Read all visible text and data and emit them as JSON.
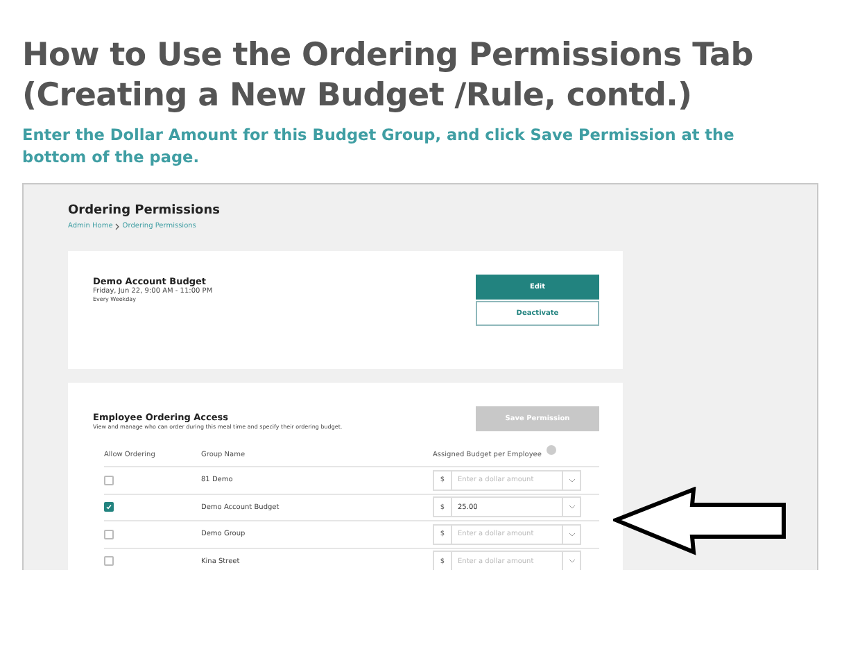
{
  "slide": {
    "title_lines": [
      "How to Use the Ordering Permissions Tab",
      "(Creating a New Budget /Rule, contd.)"
    ],
    "instruction": "Enter the Dollar Amount for this Budget Group, and click Save Permission at the bottom of the page."
  },
  "screen": {
    "page_title": "Ordering Permissions",
    "breadcrumb": [
      "Admin Home",
      "Ordering Permissions"
    ],
    "budget_card": {
      "name": "Demo Account Budget",
      "schedule": "Friday, Jun 22, 9:00 AM - 11:00 PM",
      "recurrence": "Every Weekday",
      "edit_button": "Edit",
      "deactivate_button": "Deactivate"
    },
    "access": {
      "title": "Employee Ordering Access",
      "description": "View and manage who can order during this meal time and specify their ordering budget.",
      "save_button": {
        "label": "Save Permission",
        "disabled": true
      },
      "columns": [
        "Allow Ordering",
        "Group Name",
        "Assigned Budget per Employee"
      ],
      "rows": [
        {
          "checked": false,
          "group": "81 Demo",
          "currency": "$",
          "placeholder": "Enter a dollar amount"
        },
        {
          "checked": true,
          "group": "Demo Account Budget",
          "currency": "$",
          "value": "25.00"
        },
        {
          "checked": false,
          "group": "Demo Group",
          "currency": "$",
          "placeholder": "Enter a dollar amount"
        },
        {
          "checked": false,
          "group": "Kina Street",
          "currency": "$",
          "placeholder": "Enter a dollar amount"
        }
      ]
    }
  },
  "callout": {
    "kind": "arrow"
  }
}
